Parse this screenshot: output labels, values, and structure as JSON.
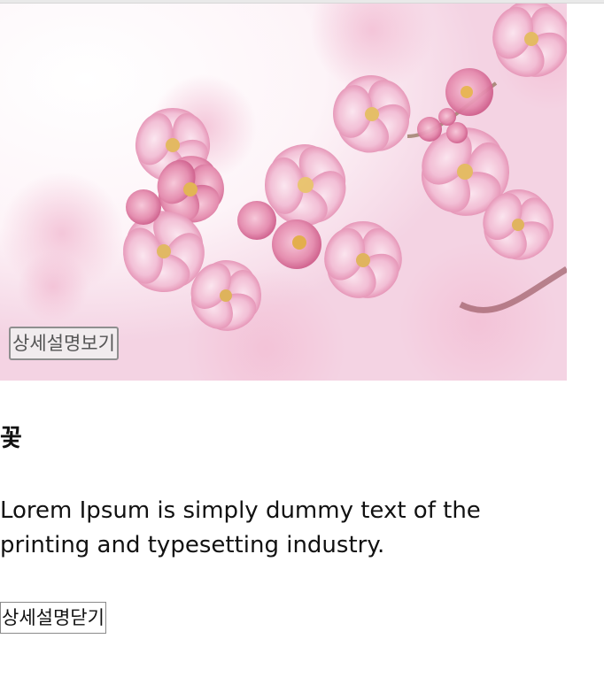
{
  "card": {
    "image_alt": "cherry blossom photo",
    "open_button_label": "상세설명보기",
    "title": "꽃",
    "description": "Lorem Ipsum is simply dummy text of the printing and typesetting industry.",
    "close_button_label": "상세설명닫기"
  },
  "colors": {
    "petal_light": "#f7d7e6",
    "petal_mid": "#efb3cd",
    "petal_deep": "#e07fa6",
    "stamen": "#d8a535",
    "branch": "#9a4b4b"
  }
}
